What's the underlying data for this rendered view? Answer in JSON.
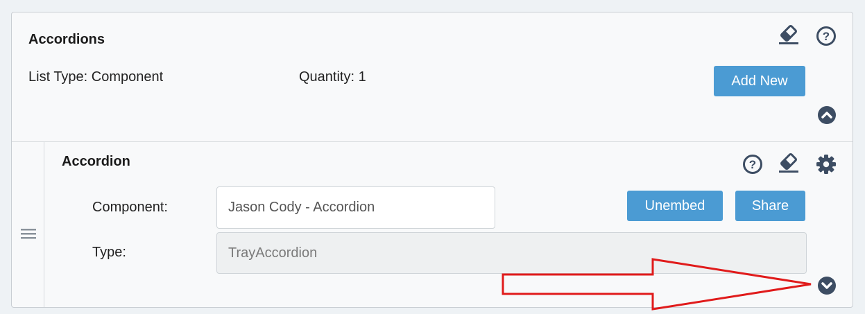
{
  "accordions": {
    "title": "Accordions",
    "list_type": "List Type: Component",
    "quantity": "Quantity: 1",
    "add_new_label": "Add New"
  },
  "item": {
    "title": "Accordion",
    "component_label": "Component:",
    "component_value": "Jason Cody - Accordion",
    "type_label": "Type:",
    "type_value": "TrayAccordion",
    "unembed_label": "Unembed",
    "share_label": "Share"
  },
  "colors": {
    "accent": "#4b9bd3",
    "icon": "#3d4d63",
    "annotation_arrow": "#e01b1b"
  },
  "icons": [
    "eraser-icon",
    "help-icon",
    "collapse-up-icon",
    "drag-handle-icon",
    "gear-icon",
    "expand-down-icon"
  ]
}
